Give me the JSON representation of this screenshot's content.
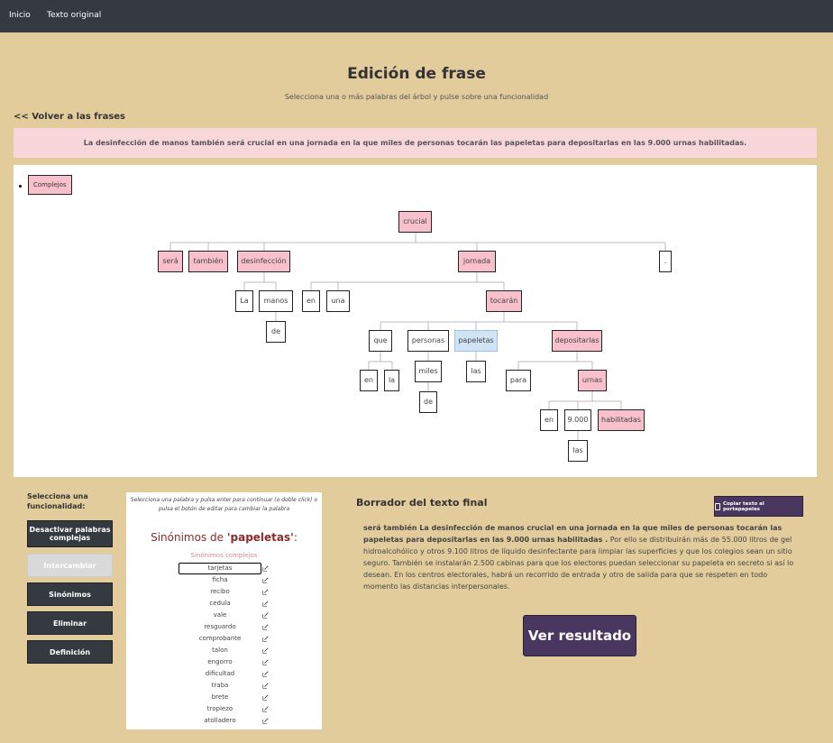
{
  "nav": {
    "home": "Inicio",
    "original": "Texto original"
  },
  "header": {
    "title": "Edición de frase",
    "subtitle": "Selecciona una o más palabras del árbol y pulse sobre una funcionalidad",
    "back": "<< Volver a las frases"
  },
  "sentence": "La desinfección de manos también será crucial en una jornada en la que miles de personas tocarán las papeletas para depositarlas en las 9.000 urnas habilitadas.",
  "tree": {
    "complejos": "Complejos",
    "nodes": [
      {
        "id": "crucial",
        "text": "crucial",
        "style": "pink"
      },
      {
        "id": "sera",
        "text": "será",
        "style": "pink"
      },
      {
        "id": "tambien",
        "text": "también",
        "style": "pink"
      },
      {
        "id": "desinfeccion",
        "text": "desinfección",
        "style": "pink"
      },
      {
        "id": "jornada",
        "text": "jornada",
        "style": "pink"
      },
      {
        "id": "punto",
        "text": ".",
        "style": "white"
      },
      {
        "id": "la1",
        "text": "La",
        "style": "white"
      },
      {
        "id": "manos",
        "text": "manos",
        "style": "white"
      },
      {
        "id": "de1",
        "text": "de",
        "style": "white"
      },
      {
        "id": "en1",
        "text": "en",
        "style": "white"
      },
      {
        "id": "una",
        "text": "una",
        "style": "white"
      },
      {
        "id": "tocaran",
        "text": "tocarán",
        "style": "pink"
      },
      {
        "id": "que",
        "text": "que",
        "style": "white"
      },
      {
        "id": "personas",
        "text": "personas",
        "style": "white"
      },
      {
        "id": "papeletas",
        "text": "papeletas",
        "style": "blue"
      },
      {
        "id": "depositarlas",
        "text": "depositarlas",
        "style": "pink"
      },
      {
        "id": "en2",
        "text": "en",
        "style": "white"
      },
      {
        "id": "la2",
        "text": "la",
        "style": "white"
      },
      {
        "id": "miles",
        "text": "miles",
        "style": "white"
      },
      {
        "id": "las1",
        "text": "las",
        "style": "white"
      },
      {
        "id": "para",
        "text": "para",
        "style": "white"
      },
      {
        "id": "urnas",
        "text": "urnas",
        "style": "pink"
      },
      {
        "id": "de2",
        "text": "de",
        "style": "white"
      },
      {
        "id": "en3",
        "text": "en",
        "style": "white"
      },
      {
        "id": "n9000",
        "text": "9.000",
        "style": "white"
      },
      {
        "id": "habilitadas",
        "text": "habilitadas",
        "style": "pink"
      },
      {
        "id": "las2",
        "text": "las",
        "style": "white"
      }
    ]
  },
  "functions": {
    "label": "Selecciona una funcionalidad:",
    "deactivate": "Desactivar palabras complejas",
    "swap": "Intercambiar",
    "synonyms": "Sinónimos",
    "delete": "Eliminar",
    "definition": "Definición"
  },
  "synonyms_panel": {
    "instructions": "Selecciona una palabra y pulsa enter para continuar (o doble click) o pulsa el botón de editar para cambiar la palabra",
    "title_prefix": "Sinónimos de ",
    "word": "'papeletas'",
    "title_suffix": ":",
    "subtitle": "Sinónimos complejos",
    "items": [
      "tarjetas",
      "ficha",
      "recibo",
      "cedula",
      "vale",
      "resguardo",
      "comprobante",
      "talon",
      "engorro",
      "dificultad",
      "traba",
      "brete",
      "tropiezo",
      "atolladero"
    ]
  },
  "draft": {
    "title": "Borrador del texto final",
    "copy": "Copiar texto al portapapeles",
    "bold_part": "será también La desinfección de manos crucial en una jornada en la que miles de personas tocarán las papeletas para depositarlas en las 9.000 urnas habilitadas .",
    "rest": " Por ello se distribuirán más de 55.000 litros de gel hidroalcohólico y otros 9.100 litros de líquido desinfectante para limpiar las superficies y que los colegios sean un sitio seguro. También se instalarán 2.500 cabinas para que los electores puedan seleccionar su papeleta en secreto si así lo desean. En los centros electorales, habrá un recorrido de entrada y otro de salida para que se respeten en todo momento las distancias interpersonales.",
    "result": "Ver resultado"
  }
}
